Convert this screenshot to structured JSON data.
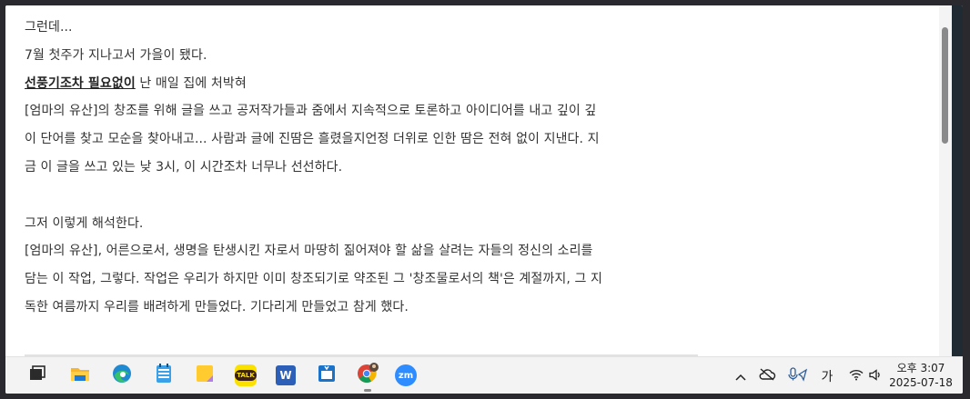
{
  "document": {
    "lines": [
      "그런데...",
      "7월 첫주가 지나고서 가을이 됐다.",
      null,
      "[엄마의 유산]의 창조를 위해 글을 쓰고 공저작가들과 줌에서 지속적으로 토론하고 아이디어를 내고 깊이 깊",
      "이 단어를 찾고 모순을 찾아내고... 사람과 글에 진땀은 흘렸을지언정 더위로 인한 땀은 전혀 없이 지낸다. 지",
      "금 이 글을 쓰고 있는 낮 3시, 이 시간조차 너무나 선선하다.",
      "",
      "그저 이렇게 해석한다.",
      "[엄마의 유산], 어른으로서, 생명을 탄생시킨 자로서 마땅히 짊어져야 할 삶을 살려는 자들의 정신의 소리를",
      "담는 이 작업, 그렇다. 작업은 우리가 하지만 이미 창조되기로 약조된 그 '창조물로서의 책'은 계절까지, 그 지",
      "독한 여름까지 우리를 배려하게 만들었다. 기다리게 만들었고 참게 했다."
    ],
    "emphasis_link": "선풍기조차 필요없이",
    "emphasis_rest": " 난 매일 집에 처박혀"
  },
  "taskbar": {
    "apps": [
      {
        "icon": "task-view-icon"
      },
      {
        "icon": "file-explorer-icon"
      },
      {
        "icon": "edge-browser-icon"
      },
      {
        "icon": "notepad-icon"
      },
      {
        "icon": "sticky-notes-icon"
      },
      {
        "icon": "kakaotalk-icon",
        "label": "TALK"
      },
      {
        "icon": "word-icon",
        "label": "W"
      },
      {
        "icon": "calendar-app-icon"
      },
      {
        "icon": "chrome-icon"
      },
      {
        "icon": "zoom-icon",
        "label": "zm"
      }
    ],
    "tray": {
      "ime_label": "가",
      "time": "오후 3:07",
      "date": "2025-07-18"
    }
  }
}
